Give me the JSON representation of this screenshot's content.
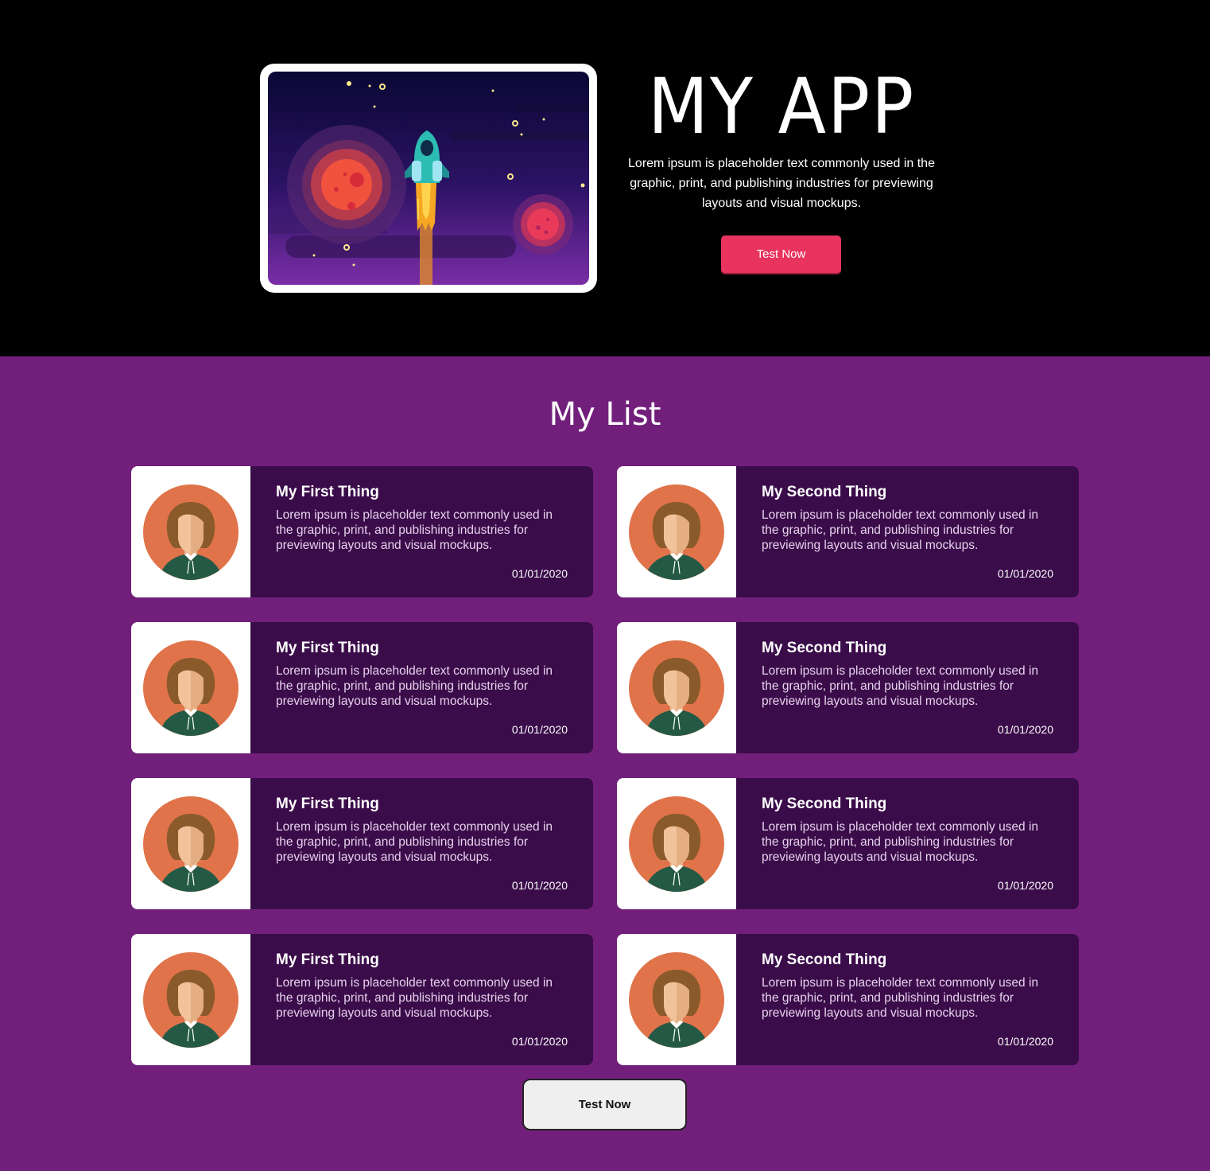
{
  "hero": {
    "title": "MY APP",
    "description": "Lorem ipsum is placeholder text commonly used in the graphic, print, and publishing industries for previewing layouts and visual mockups.",
    "button_label": "Test Now",
    "illustration_icon": "rocket-space-illustration"
  },
  "list": {
    "title": "My List",
    "items": [
      {
        "title": "My First Thing",
        "description": "Lorem ipsum is placeholder text commonly used in the graphic, print, and publishing industries for previewing layouts and visual mockups.",
        "date": "01/01/2020",
        "avatar": "woman-avatar-icon"
      },
      {
        "title": "My Second Thing",
        "description": "Lorem ipsum is placeholder text commonly used in the graphic, print, and publishing industries for previewing layouts and visual mockups.",
        "date": "01/01/2020",
        "avatar": "woman-avatar-icon"
      },
      {
        "title": "My First Thing",
        "description": "Lorem ipsum is placeholder text commonly used in the graphic, print, and publishing industries for previewing layouts and visual mockups.",
        "date": "01/01/2020",
        "avatar": "woman-avatar-icon"
      },
      {
        "title": "My Second Thing",
        "description": "Lorem ipsum is placeholder text commonly used in the graphic, print, and publishing industries for previewing layouts and visual mockups.",
        "date": "01/01/2020",
        "avatar": "woman-avatar-icon"
      },
      {
        "title": "My First Thing",
        "description": "Lorem ipsum is placeholder text commonly used in the graphic, print, and publishing industries for previewing layouts and visual mockups.",
        "date": "01/01/2020",
        "avatar": "woman-avatar-icon"
      },
      {
        "title": "My Second Thing",
        "description": "Lorem ipsum is placeholder text commonly used in the graphic, print, and publishing industries for previewing layouts and visual mockups.",
        "date": "01/01/2020",
        "avatar": "woman-avatar-icon"
      },
      {
        "title": "My First Thing",
        "description": "Lorem ipsum is placeholder text commonly used in the graphic, print, and publishing industries for previewing layouts and visual mockups.",
        "date": "01/01/2020",
        "avatar": "woman-avatar-icon"
      },
      {
        "title": "My Second Thing",
        "description": "Lorem ipsum is placeholder text commonly used in the graphic, print, and publishing industries for previewing layouts and visual mockups.",
        "date": "01/01/2020",
        "avatar": "woman-avatar-icon"
      }
    ],
    "button_label": "Test Now"
  },
  "colors": {
    "hero_background": "#000000",
    "page_background": "#721f7c",
    "card_background": "#3b0c4a",
    "accent_button": "#e8335e"
  }
}
